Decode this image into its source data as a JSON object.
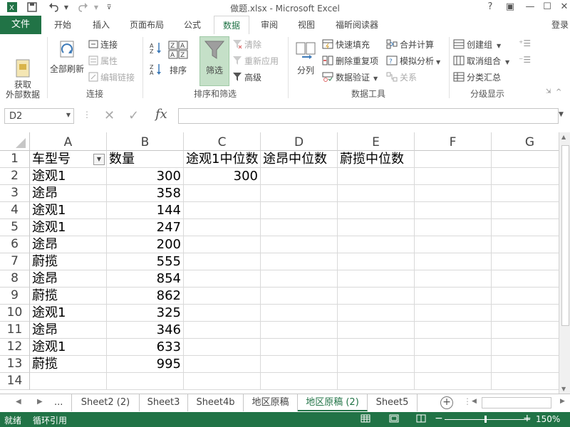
{
  "window": {
    "title": "做题.xlsx - Microsoft Excel",
    "controls": {
      "help": "?",
      "restore": "▣",
      "minimize": "—",
      "maximize": "☐",
      "close": "✕"
    }
  },
  "ribbon_tabs": {
    "file": "文件",
    "items": [
      "开始",
      "插入",
      "页面布局",
      "公式",
      "数据",
      "审阅",
      "视图",
      "福昕阅读器"
    ],
    "active": "数据",
    "login": "登录"
  },
  "ribbon": {
    "get_external": "获取\n外部数据",
    "refresh_all": "全部刷新",
    "connections": "连接",
    "properties": "属性",
    "edit_links": "编辑链接",
    "group_connections": "连接",
    "sort": "排序",
    "filter": "筛选",
    "clear": "清除",
    "reapply": "重新应用",
    "advanced": "高级",
    "group_sort_filter": "排序和筛选",
    "text_to_columns": "分列",
    "flash_fill": "快速填充",
    "remove_duplicates": "删除重复项",
    "data_validation": "数据验证",
    "consolidate": "合并计算",
    "what_if": "模拟分析",
    "relationships": "关系",
    "group_data_tools": "数据工具",
    "group_create": "创建组",
    "ungroup": "取消组合",
    "subtotal": "分类汇总",
    "group_outline": "分级显示"
  },
  "formula_bar": {
    "name_box": "D2",
    "fx": "fx",
    "formula": ""
  },
  "grid": {
    "columns": [
      "A",
      "B",
      "C",
      "D",
      "E",
      "F",
      "G"
    ],
    "rows": [
      {
        "n": "1",
        "A": "车型号",
        "B": "数量",
        "C": "途观1中位数",
        "D": "途昂中位数",
        "E": "蔚揽中位数"
      },
      {
        "n": "2",
        "A": "途观1",
        "B": "300",
        "C": "300"
      },
      {
        "n": "3",
        "A": "途昂",
        "B": "358"
      },
      {
        "n": "4",
        "A": "途观1",
        "B": "144"
      },
      {
        "n": "5",
        "A": "途观1",
        "B": "247"
      },
      {
        "n": "6",
        "A": "途昂",
        "B": "200"
      },
      {
        "n": "7",
        "A": "蔚揽",
        "B": "555"
      },
      {
        "n": "8",
        "A": "途昂",
        "B": "854"
      },
      {
        "n": "9",
        "A": "蔚揽",
        "B": "862"
      },
      {
        "n": "10",
        "A": "途观1",
        "B": "325"
      },
      {
        "n": "11",
        "A": "途昂",
        "B": "346"
      },
      {
        "n": "12",
        "A": "途观1",
        "B": "633"
      },
      {
        "n": "13",
        "A": "蔚揽",
        "B": "995"
      },
      {
        "n": "14"
      }
    ],
    "selected_cell": "D2"
  },
  "sheet_tabs": {
    "ellipsis": "...",
    "items": [
      "Sheet2 (2)",
      "Sheet3",
      "Sheet4b",
      "地区原稿",
      "地区原稿 (2)",
      "Sheet5"
    ],
    "active": "地区原稿 (2)"
  },
  "status_bar": {
    "ready": "就绪",
    "circular": "循环引用",
    "zoom": "150%"
  },
  "colors": {
    "accent": "#217346",
    "selected_button": "#c5e0c8"
  }
}
